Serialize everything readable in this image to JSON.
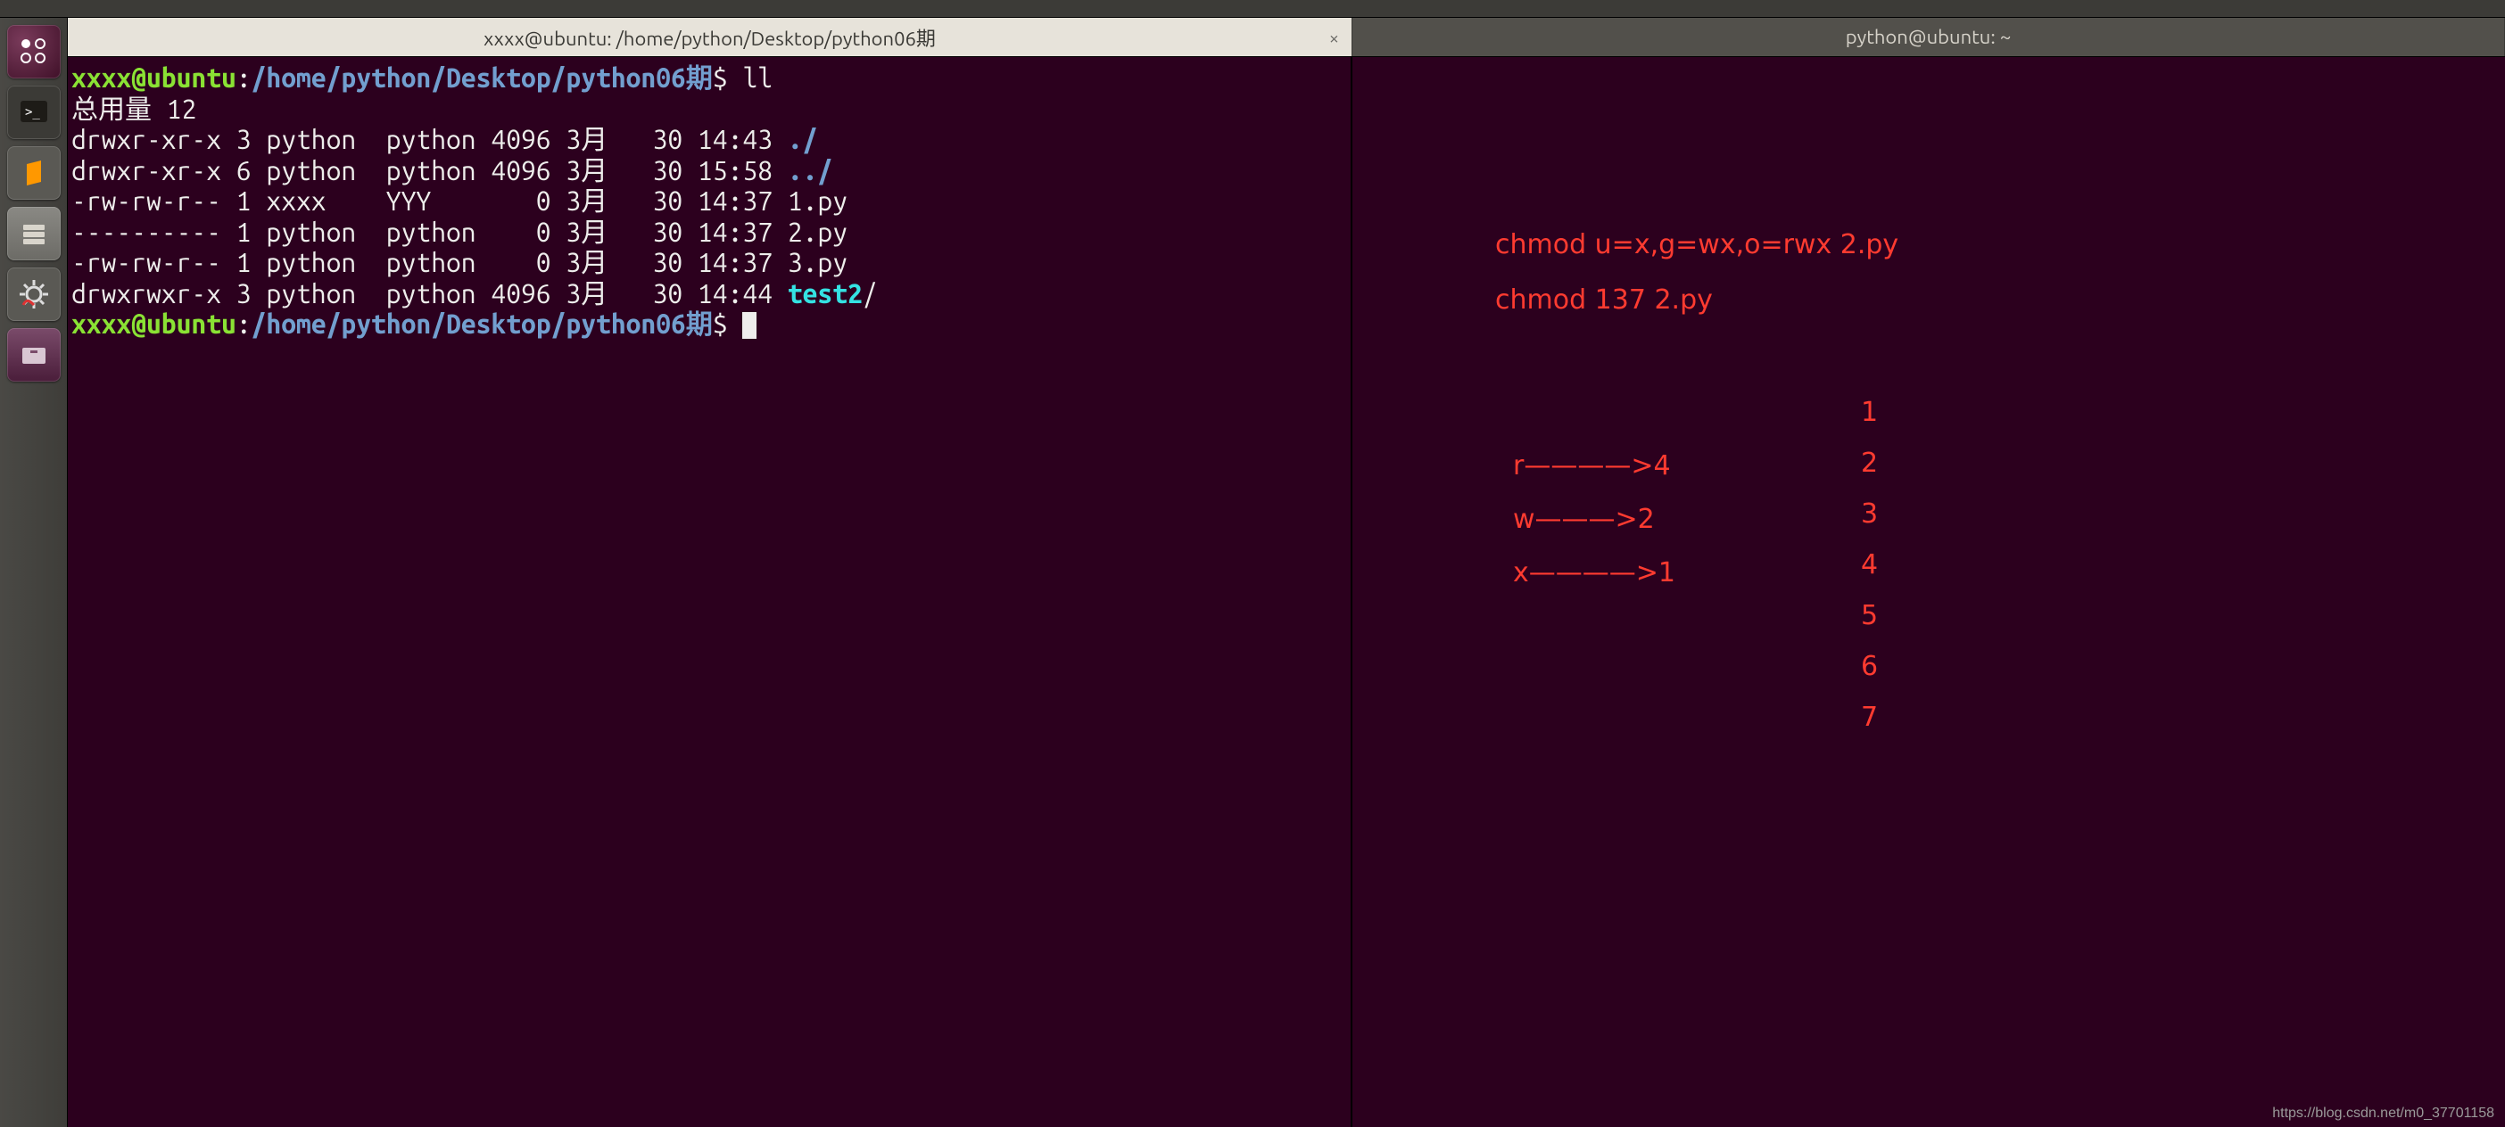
{
  "top_strip": {
    "text": ""
  },
  "tabs": {
    "active": {
      "title": "xxxx@ubuntu: /home/python/Desktop/python06期"
    },
    "inactive": {
      "title": "python@ubuntu: ~"
    }
  },
  "prompt": {
    "user": "xxxx@ubuntu",
    "sep": ":",
    "path": "/home/python/Desktop/python06期",
    "sigil": "$"
  },
  "terminal_left": {
    "cmd1": "ll",
    "total_label": "总用量 12",
    "rows": [
      {
        "perm": "drwxr-xr-x",
        "nlink": "3",
        "owner": "python",
        "group": "python",
        "size": "4096",
        "month": "3月",
        "day": "30",
        "time": "14:43",
        "name": "./",
        "cls": "c-dir"
      },
      {
        "perm": "drwxr-xr-x",
        "nlink": "6",
        "owner": "python",
        "group": "python",
        "size": "4096",
        "month": "3月",
        "day": "30",
        "time": "15:58",
        "name": "../",
        "cls": "c-dir"
      },
      {
        "perm": "-rw-rw-r--",
        "nlink": "1",
        "owner": "xxxx",
        "group": "YYY",
        "size": "0",
        "month": "3月",
        "day": "30",
        "time": "14:37",
        "name": "1.py",
        "cls": "c-white"
      },
      {
        "perm": "----------",
        "nlink": "1",
        "owner": "python",
        "group": "python",
        "size": "0",
        "month": "3月",
        "day": "30",
        "time": "14:37",
        "name": "2.py",
        "cls": "c-white"
      },
      {
        "perm": "-rw-rw-r--",
        "nlink": "1",
        "owner": "python",
        "group": "python",
        "size": "0",
        "month": "3月",
        "day": "30",
        "time": "14:37",
        "name": "3.py",
        "cls": "c-white"
      },
      {
        "perm": "drwxrwxr-x",
        "nlink": "3",
        "owner": "python",
        "group": "python",
        "size": "4096",
        "month": "3月",
        "day": "30",
        "time": "14:44",
        "name": "test2",
        "suffix": "/",
        "cls": "c-link"
      }
    ]
  },
  "annotations": {
    "cmd_sym": "chmod u=x,g=wx,o=rwx 2.py",
    "cmd_oct": "chmod 137 2.py",
    "map_r": "r————>4",
    "map_w": "w———>2",
    "map_x": "x————>1",
    "nums": [
      "1",
      "2",
      "3",
      "4",
      "5",
      "6",
      "7"
    ]
  },
  "watermark": "https://blog.csdn.net/m0_37701158",
  "icons": {
    "dash": "dash-icon",
    "terminal": "terminal-icon",
    "sublime": "sublime-icon",
    "files": "files-icon",
    "settings": "settings-icon",
    "drawer": "drawer-icon"
  }
}
